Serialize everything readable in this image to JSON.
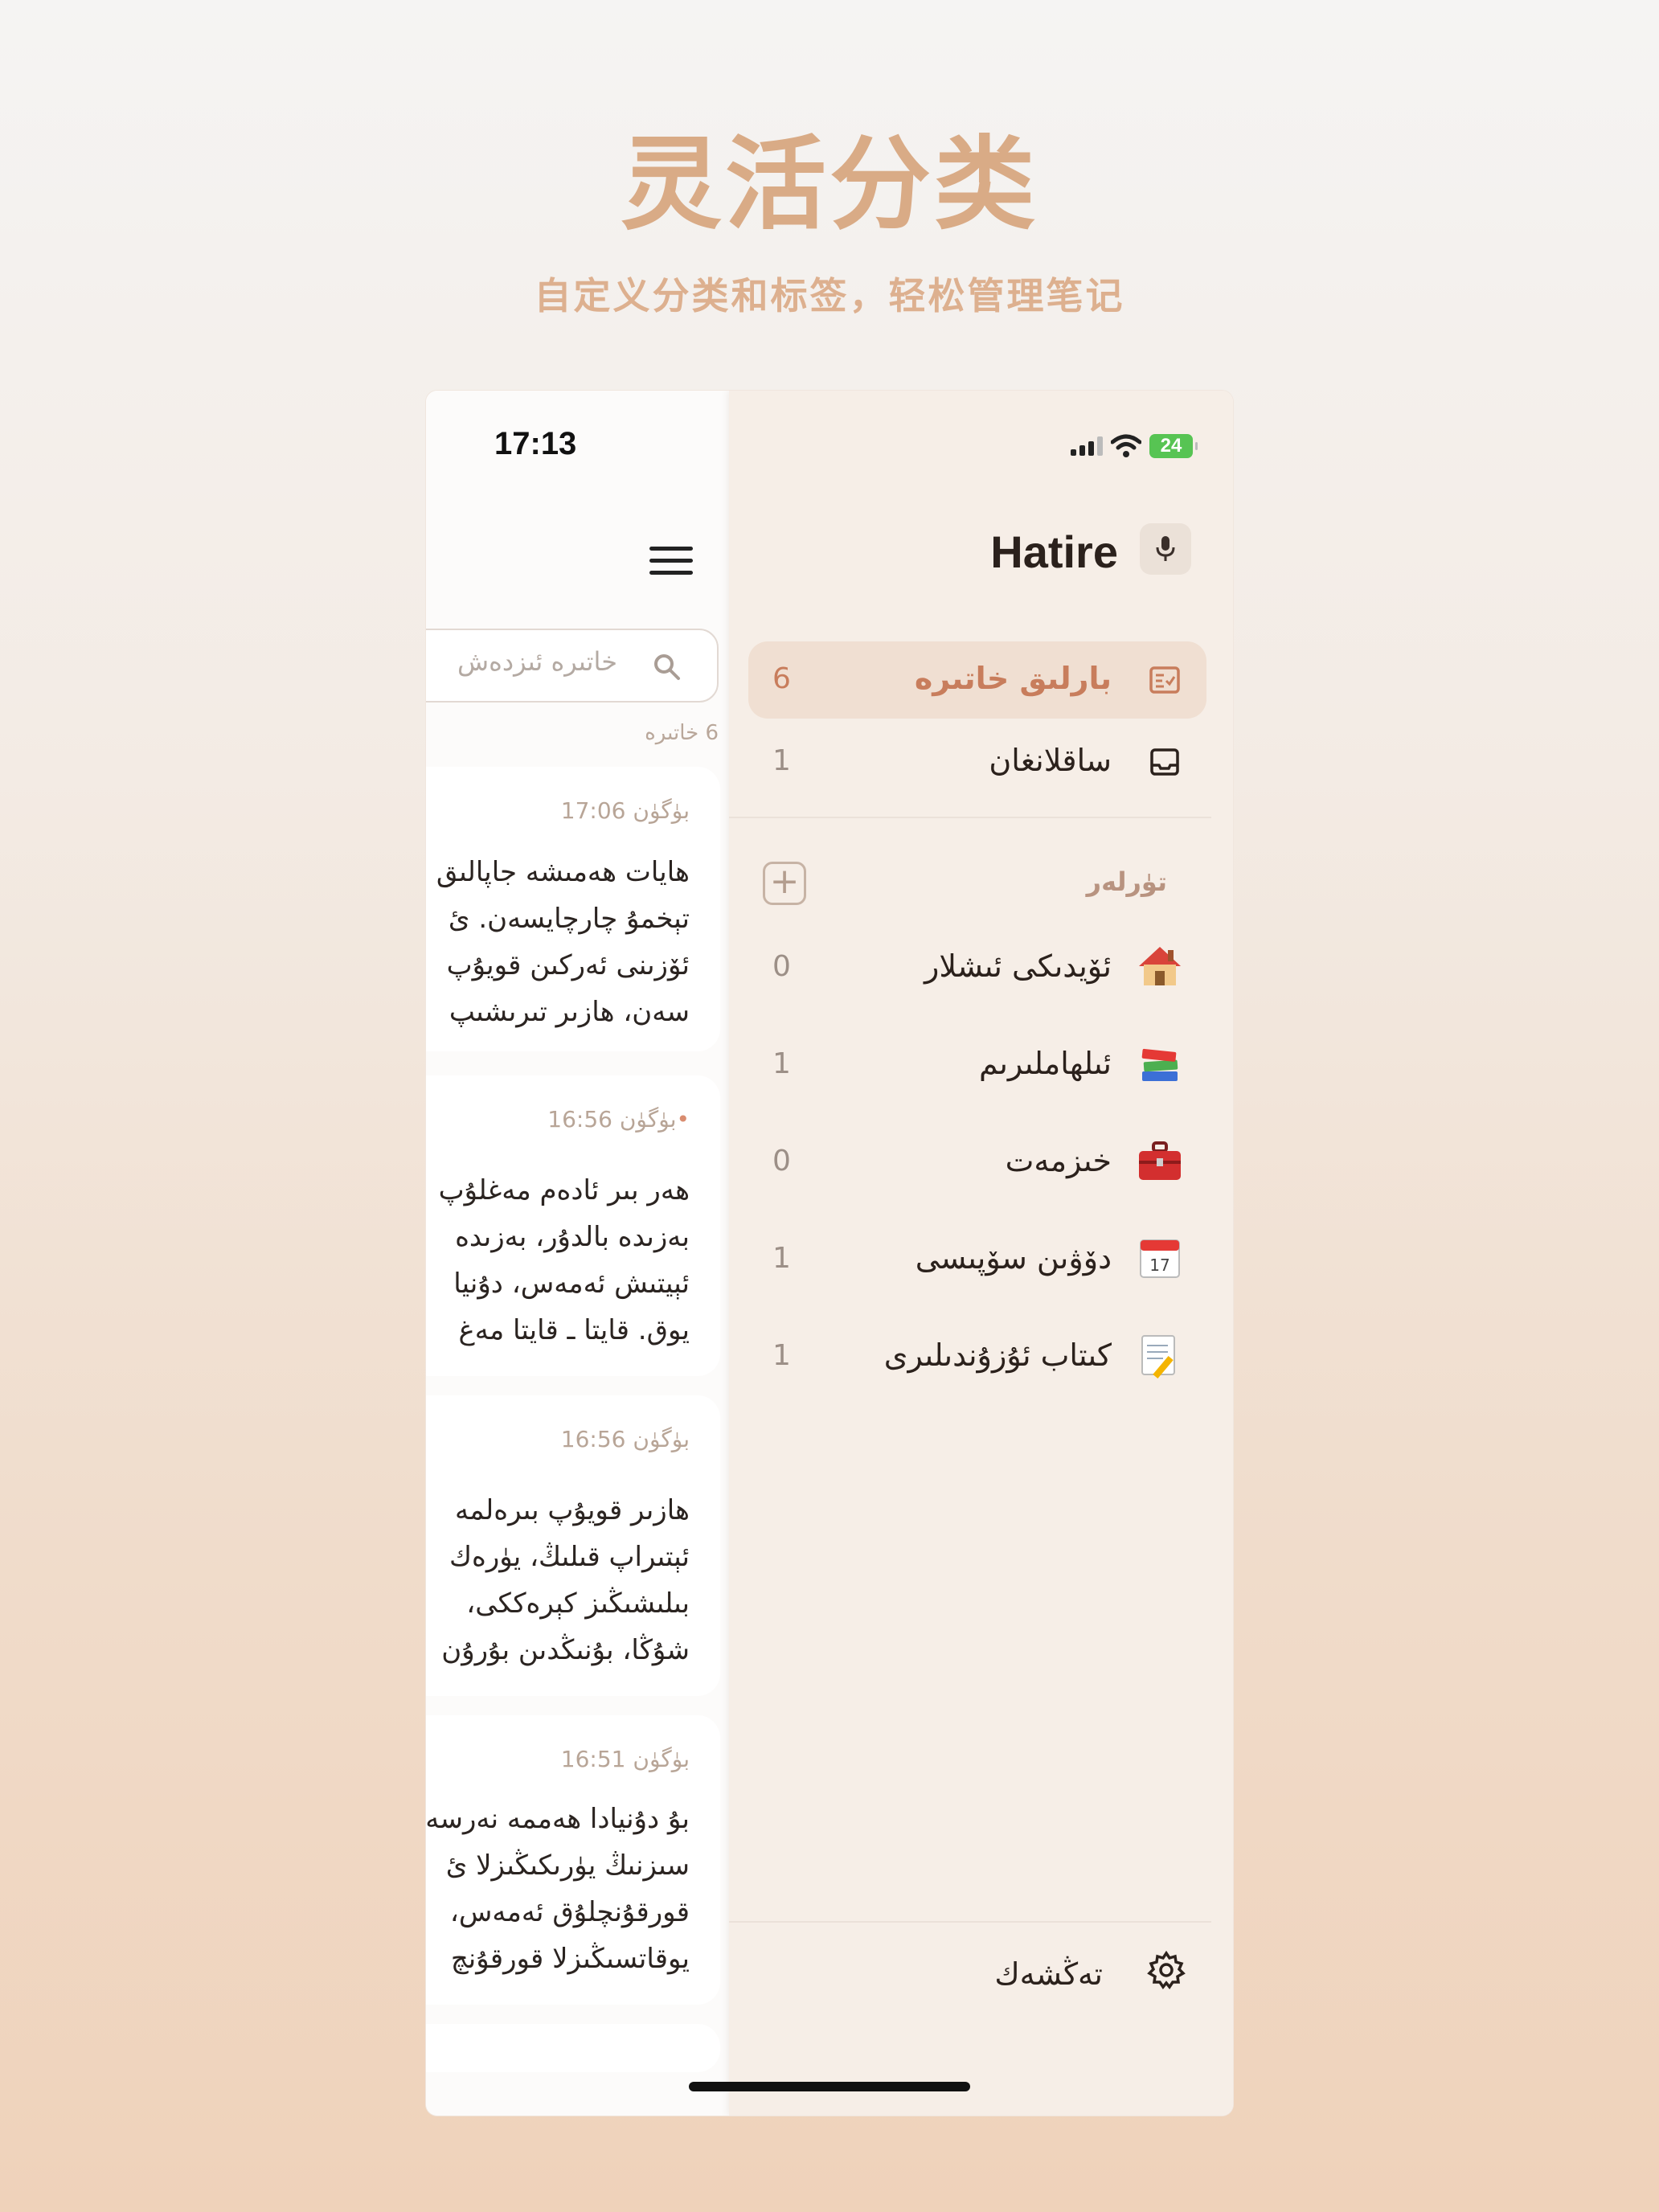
{
  "promo": {
    "headline": "灵活分类",
    "subline": "自定义分类和标签，轻松管理笔记"
  },
  "status_bar": {
    "time": "17:13",
    "battery": "24"
  },
  "notes_list": {
    "search_placeholder": "خاتىرە ئىزدەش",
    "count": "6 خاتىرە",
    "notes": [
      {
        "time": "بۈگۈن 17:06",
        "unsynced": false,
        "lines": [
          "ھايات ھەمىشە جاپالىق",
          "تېخمۇ چارچايسەن. ئ",
          "ئۆزىنى ئەركىن قويۇپ",
          "سەن، ھازىر تىرىشىپ"
        ]
      },
      {
        "time": "بۈگۈن 16:56",
        "unsynced": true,
        "lines": [
          "ھەر بىر ئادەم مەغلۇپ",
          "بەزىدە بالدۇر، بەزىدە",
          "ئېيتىش ئەمەس، دۇنيا",
          "يوق. قايتا ـ قايتا مەغ"
        ]
      },
      {
        "time": "بۈگۈن 16:56",
        "unsynced": false,
        "lines": [
          "ھازىر قويۇپ بىرەلمە",
          "ئېتىراپ قىلىڭ، يۈرەك",
          "بىلىشىڭىز كېرەككى،",
          "شۇڭا، بۇنىڭدىن بۇرۇن"
        ]
      },
      {
        "time": "بۈگۈن 16:51",
        "unsynced": false,
        "lines": [
          "بۇ دۇنيادا ھەممە نەرسە",
          "سىزنىڭ يۈرىكىڭىزلا ئ",
          "قورقۇنچلۇق ئەمەس،",
          "يوقاتسىڭىزلا قورقۇنچ"
        ]
      }
    ]
  },
  "drawer": {
    "app_title": "Hatire",
    "nav": [
      {
        "label": "بارلىق خاتىرە",
        "count": "6",
        "icon": "all-notes-icon",
        "active": true
      },
      {
        "label": "ساقلانغان",
        "count": "1",
        "icon": "inbox-icon",
        "active": false
      }
    ],
    "categories_title": "تۈرلەر",
    "categories": [
      {
        "label": "ئۆيدىكى ئىشلار",
        "count": "0",
        "icon": "house-icon"
      },
      {
        "label": "ئىلھاملىرىم",
        "count": "1",
        "icon": "books-icon"
      },
      {
        "label": "خىزمەت",
        "count": "0",
        "icon": "toolbox-icon"
      },
      {
        "label": "دۆۋىن سۆپىسى",
        "count": "1",
        "icon": "calendar-icon"
      },
      {
        "label": "كىتاب ئۇزۇندىلىرى",
        "count": "1",
        "icon": "memo-icon"
      }
    ],
    "settings_label": "تەڭشەك"
  }
}
